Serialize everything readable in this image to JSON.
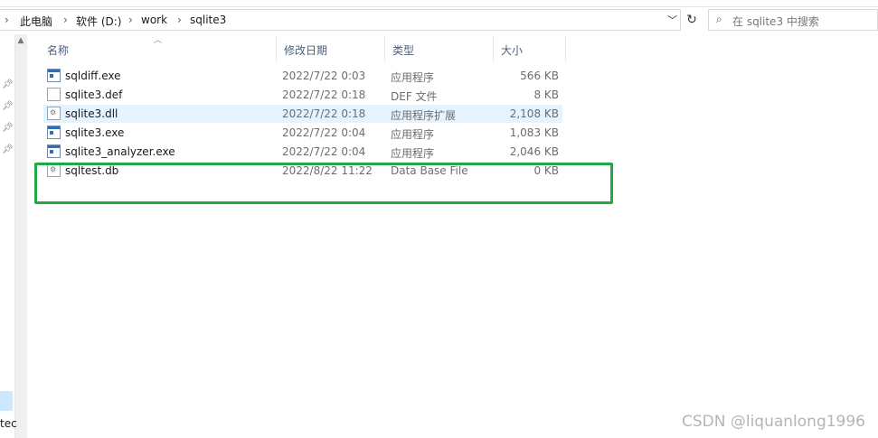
{
  "breadcrumb": {
    "items": [
      "此电脑",
      "软件 (D:)",
      "work",
      "sqlite3"
    ]
  },
  "search": {
    "placeholder": "在 sqlite3 中搜索"
  },
  "columns": {
    "name": "名称",
    "date": "修改日期",
    "type": "类型",
    "size": "大小"
  },
  "files": [
    {
      "name": "sqldiff.exe",
      "date": "2022/7/22 0:03",
      "type": "应用程序",
      "size": "566 KB",
      "icon": "exe-icon"
    },
    {
      "name": "sqlite3.def",
      "date": "2022/7/22 0:18",
      "type": "DEF 文件",
      "size": "8 KB",
      "icon": "document-icon"
    },
    {
      "name": "sqlite3.dll",
      "date": "2022/7/22 0:18",
      "type": "应用程序扩展",
      "size": "2,108 KB",
      "icon": "dll-icon"
    },
    {
      "name": "sqlite3.exe",
      "date": "2022/7/22 0:04",
      "type": "应用程序",
      "size": "1,083 KB",
      "icon": "exe-icon"
    },
    {
      "name": "sqlite3_analyzer.exe",
      "date": "2022/7/22 0:04",
      "type": "应用程序",
      "size": "2,046 KB",
      "icon": "exe-icon"
    },
    {
      "name": "sqltest.db",
      "date": "2022/8/22 11:22",
      "type": "Data Base File",
      "size": "0 KB",
      "icon": "db-file-icon"
    }
  ],
  "nav": {
    "partial_label": "tec"
  },
  "watermark": "CSDN @liquanlong1996",
  "colors": {
    "selection": "#e5f3ff",
    "highlight_box": "#22a845",
    "header_text": "#4c607a"
  }
}
